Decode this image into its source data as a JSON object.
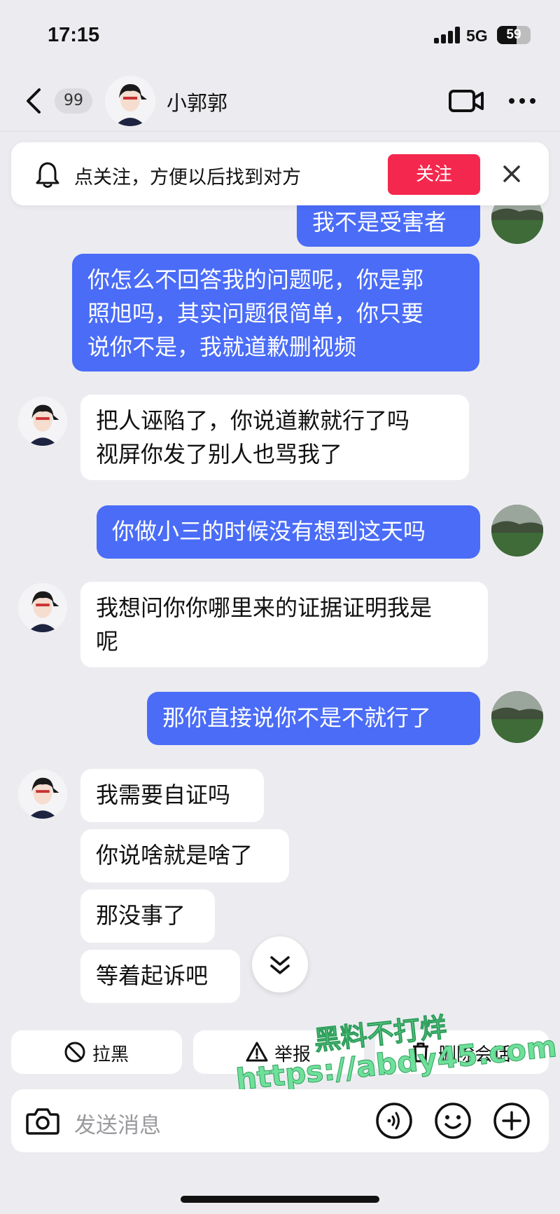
{
  "status_bar": {
    "time": "17:15",
    "network": "5G",
    "battery": "59",
    "battery_level": 0.59
  },
  "header": {
    "back_badge": "99",
    "contact_name": "小郭郭"
  },
  "follow_bar": {
    "text": "点关注，方便以后找到对方",
    "button_label": "关注"
  },
  "messages": [
    {
      "from": "me",
      "text": "我不是受害者"
    },
    {
      "from": "me",
      "lines": [
        "你怎么不回答我的问题呢，你是郭",
        "照旭吗，其实问题很简单，你只要",
        "说你不是，我就道歉删视频"
      ]
    },
    {
      "from": "them",
      "lines": [
        "把人诬陷了，你说道歉就行了吗",
        "视屏你发了别人也骂我了"
      ]
    },
    {
      "from": "me",
      "text": "你做小三的时候没有想到这天吗"
    },
    {
      "from": "them",
      "lines": [
        "我想问你你哪里来的证据证明我是",
        "呢"
      ]
    },
    {
      "from": "me",
      "text": "那你直接说你不是不就行了"
    },
    {
      "from": "them",
      "text": "我需要自证吗"
    },
    {
      "from": "them",
      "text": "你说啥就是啥了"
    },
    {
      "from": "them",
      "text": "那没事了"
    },
    {
      "from": "them",
      "text": "等着起诉吧"
    }
  ],
  "actions": {
    "block": "拉黑",
    "report": "举报",
    "delete": "删除会话"
  },
  "watermark": {
    "line1": "黑料不打烊",
    "line2": "https://abdy45.com"
  },
  "input": {
    "placeholder": "发送消息"
  },
  "colors": {
    "my_bubble": "#4a6cf7",
    "their_bubble": "#ffffff",
    "follow_button": "#f4284e",
    "background": "#ececf0"
  }
}
